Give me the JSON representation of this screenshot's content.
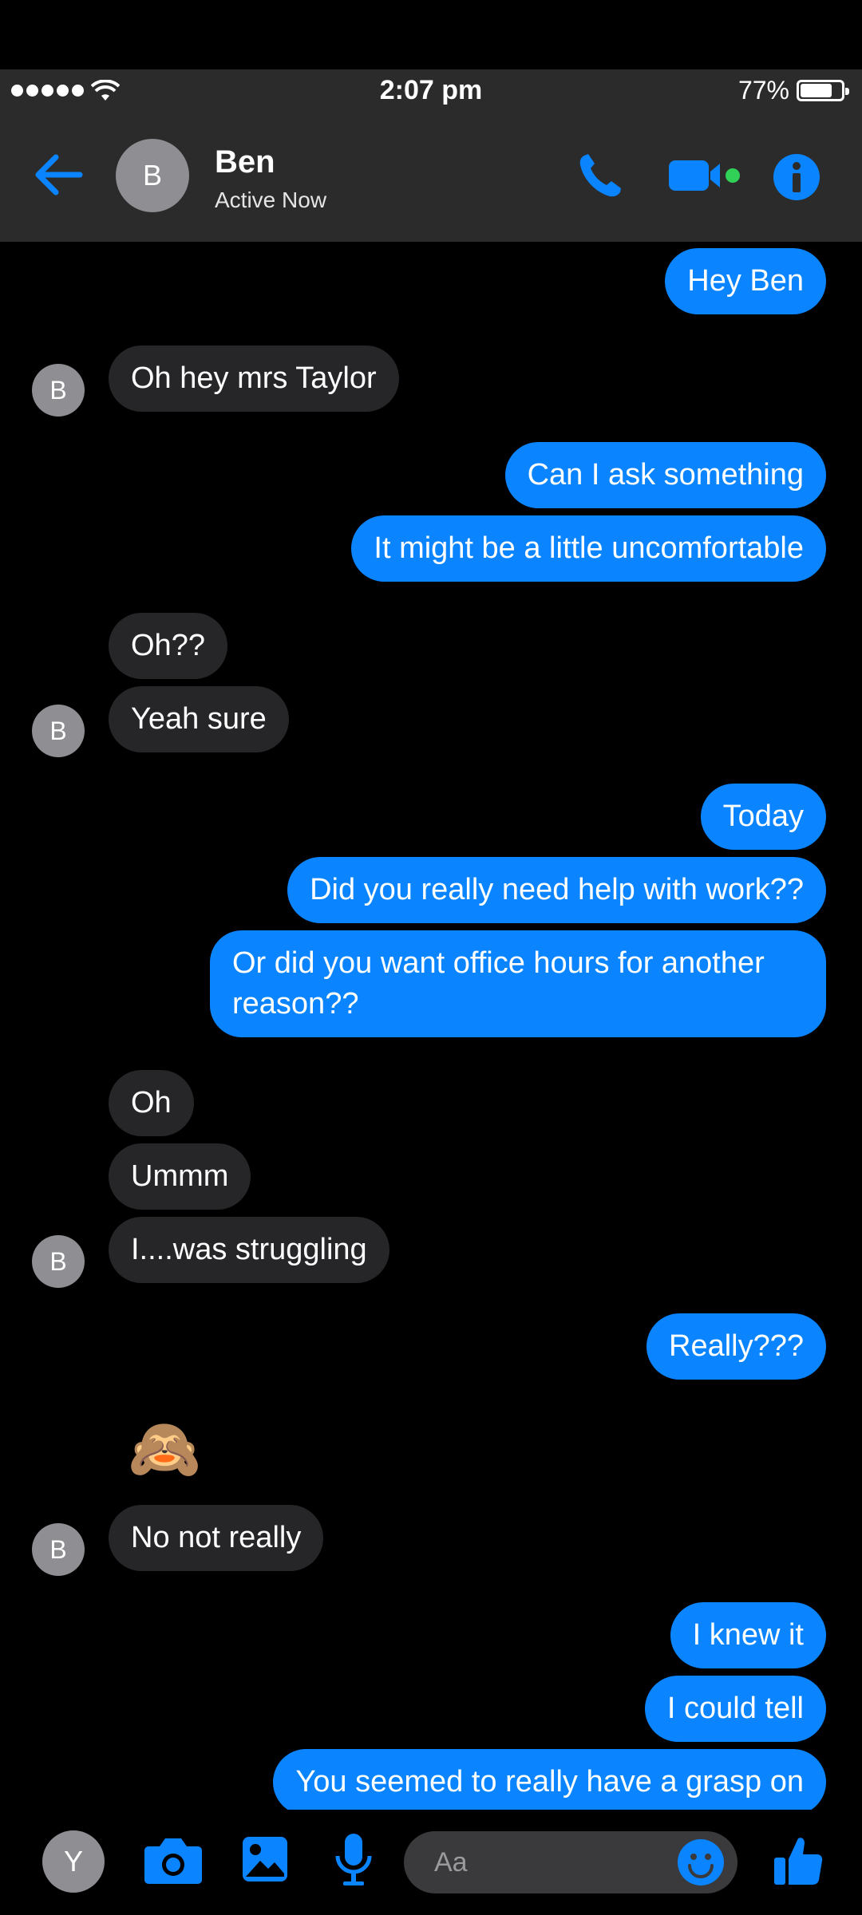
{
  "status_bar": {
    "time": "2:07 pm",
    "battery_percent": "77%",
    "battery_level": 0.77,
    "signal_bars": 5
  },
  "header": {
    "avatar_initial": "B",
    "contact_name": "Ben",
    "contact_status": "Active Now",
    "icons": [
      "back-arrow-icon",
      "phone-icon",
      "video-camera-icon",
      "info-icon"
    ],
    "accent_color": "#0a84ff",
    "active_dot_color": "#31d158"
  },
  "messages": [
    {
      "direction": "out",
      "text": "Hey Ben"
    },
    {
      "direction": "in",
      "text": "Oh hey mrs Taylor"
    },
    {
      "direction": "out",
      "text": "Can I ask something"
    },
    {
      "direction": "out",
      "text": "It might be a little uncomfortable"
    },
    {
      "direction": "in",
      "text": "Oh??"
    },
    {
      "direction": "in",
      "text": "Yeah sure"
    },
    {
      "direction": "out",
      "text": "Today"
    },
    {
      "direction": "out",
      "text": "Did you really need help with work??"
    },
    {
      "direction": "out",
      "text": "Or did you want office hours for another reason??"
    },
    {
      "direction": "in",
      "text": "Oh"
    },
    {
      "direction": "in",
      "text": "Ummm"
    },
    {
      "direction": "in",
      "text": "I....was struggling"
    },
    {
      "direction": "out",
      "text": "Really???"
    },
    {
      "direction": "in",
      "text": "🙈"
    },
    {
      "direction": "in",
      "text": "No not really"
    },
    {
      "direction": "out",
      "text": "I knew it"
    },
    {
      "direction": "out",
      "text": "I could tell"
    },
    {
      "direction": "out",
      "text": "You seemed to really have a grasp on"
    }
  ],
  "incoming_avatar_initial": "B",
  "composer": {
    "avatar_initial": "Y",
    "placeholder": "Aa",
    "icons": [
      "camera-icon",
      "photo-icon",
      "microphone-icon",
      "emoji-icon",
      "thumbs-up-icon"
    ]
  }
}
